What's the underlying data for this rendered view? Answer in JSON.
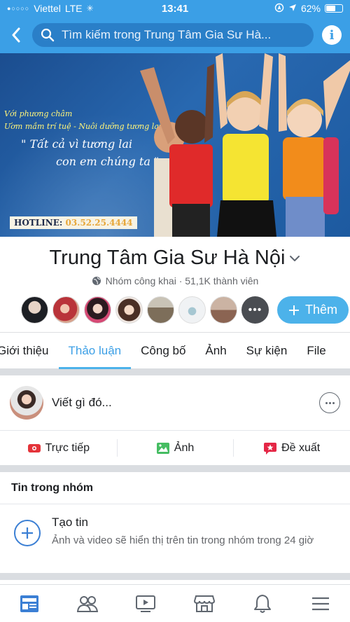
{
  "status": {
    "carrier": "Viettel",
    "network": "LTE",
    "time": "13:41",
    "battery": "62%",
    "battery_level": 0.62
  },
  "nav": {
    "search_placeholder": "Tìm kiếm trong Trung Tâm Gia Sư Hà...",
    "back_icon": "chevron-left-icon",
    "info_icon": "info-icon"
  },
  "cover": {
    "line1": "Với phương châm",
    "line2": "Ươm mầm trí tuệ - Nuôi dưỡng tương lai",
    "line3": "\" Tất cả vì tương lai",
    "line4": "con em chúng ta \"",
    "hotline_label": "HOTLINE: ",
    "hotline_number": "03.52.25.4444"
  },
  "group": {
    "name": "Trung Tâm Gia Sư Hà Nội",
    "meta": "Nhóm công khai · 51,1K thành viên",
    "add_label": "Thêm"
  },
  "tabs": [
    "Giới thiệu",
    "Thảo luận",
    "Công bố",
    "Ảnh",
    "Sự kiện",
    "File"
  ],
  "composer": {
    "placeholder": "Viết gì đó...",
    "actions": [
      "Trực tiếp",
      "Ảnh",
      "Đề xuất"
    ]
  },
  "stories": {
    "title": "Tin trong nhóm",
    "create_title": "Tạo tin",
    "create_desc": "Ảnh và video sẽ hiển thị trên tin trong nhóm trong 24 giờ"
  },
  "colors": {
    "primary": "#3b9fe6",
    "accent": "#4cb2ea"
  }
}
